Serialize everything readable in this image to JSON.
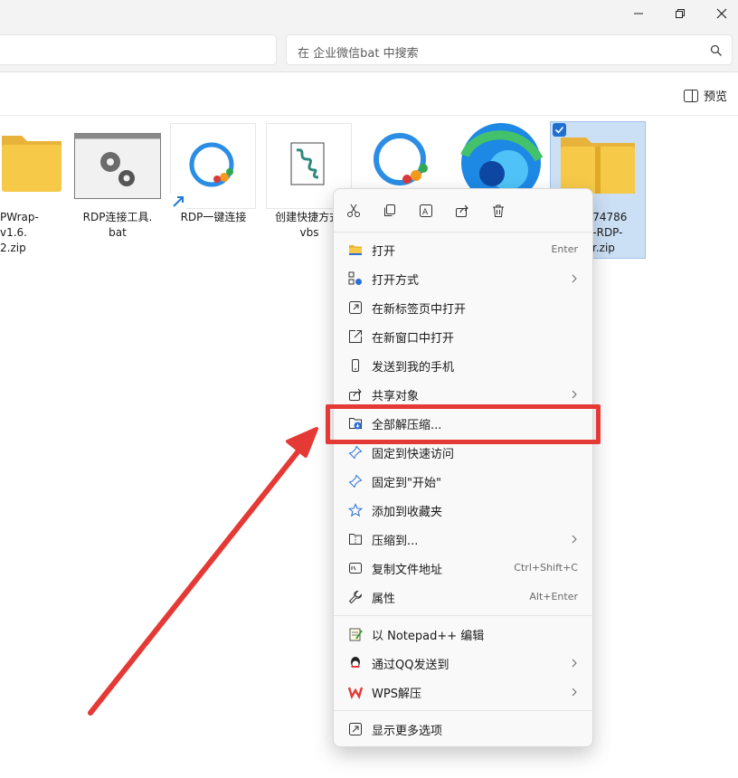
{
  "search": {
    "placeholder": "在 企业微信bat 中搜索"
  },
  "toolbar": {
    "preview_label": "预览"
  },
  "files": [
    {
      "label": "PWrap-v1.6.\n2.zip"
    },
    {
      "label": "RDP连接工具.\nbat"
    },
    {
      "label": "RDP一键连接"
    },
    {
      "label": "创建快捷方式.\nvbs"
    },
    {
      "label": ""
    },
    {
      "label": ""
    },
    {
      "label": "3074786\n33-RDP-\nper.zip"
    }
  ],
  "context_menu": {
    "items": [
      {
        "label": "打开",
        "shortcut": "Enter",
        "icon": "folder-open-icon"
      },
      {
        "label": "打开方式",
        "submenu": true,
        "icon": "open-with-icon"
      },
      {
        "label": "在新标签页中打开",
        "icon": "new-tab-icon"
      },
      {
        "label": "在新窗口中打开",
        "icon": "new-window-icon"
      },
      {
        "label": "发送到我的手机",
        "icon": "phone-icon"
      },
      {
        "label": "共享对象",
        "submenu": true,
        "icon": "share-icon"
      },
      {
        "label": "全部解压缩...",
        "icon": "extract-all-icon"
      },
      {
        "label": "固定到快速访问",
        "icon": "pin-icon"
      },
      {
        "label": "固定到\"开始\"",
        "icon": "pin-start-icon"
      },
      {
        "label": "添加到收藏夹",
        "icon": "star-icon"
      },
      {
        "label": "压缩到...",
        "submenu": true,
        "icon": "compress-icon"
      },
      {
        "label": "复制文件地址",
        "shortcut": "Ctrl+Shift+C",
        "icon": "copy-path-icon"
      },
      {
        "label": "属性",
        "shortcut": "Alt+Enter",
        "icon": "wrench-icon"
      },
      {
        "label": "以 Notepad++ 编辑",
        "icon": "notepad-plus-icon"
      },
      {
        "label": "通过QQ发送到",
        "submenu": true,
        "icon": "qq-icon"
      },
      {
        "label": "WPS解压",
        "submenu": true,
        "icon": "wps-icon"
      },
      {
        "label": "显示更多选项",
        "icon": "more-options-icon"
      }
    ]
  },
  "colors": {
    "accent": "#1f6fd1",
    "highlight_red": "#e53935",
    "zip_yellow": "#f7c948"
  }
}
